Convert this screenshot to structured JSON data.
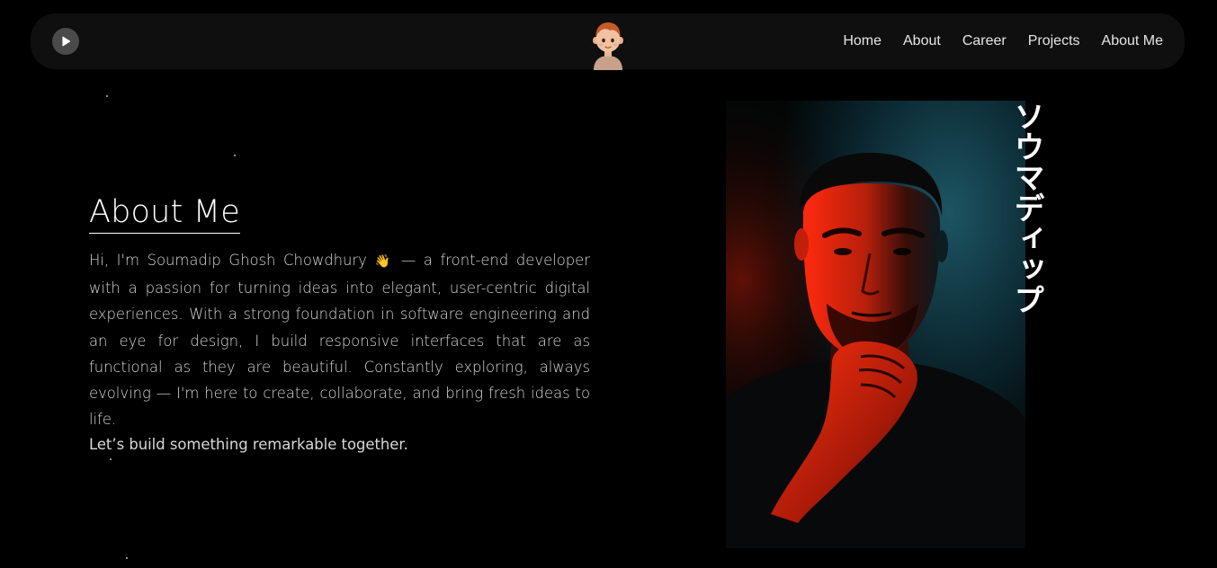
{
  "navbar": {
    "play_icon": "play-icon",
    "avatar_icon": "cartoon-boy-avatar",
    "links": [
      "Home",
      "About",
      "Career",
      "Projects",
      "About Me"
    ]
  },
  "about": {
    "title": "About Me",
    "intro_before_emoji": "Hi, I'm Soumadip Ghosh Chowdhury",
    "emoji": "👋",
    "paragraph_rest": "— a front-end developer with a passion for turning ideas into elegant, user-centric digital experiences. With a strong foundation in software engineering and an eye for design, I build responsive interfaces that are as functional as they are beautiful. Constantly exploring, always evolving — I'm here to create, collaborate, and bring fresh ideas to life.",
    "closing": "Let’s build something remarkable together."
  },
  "portrait": {
    "name_katakana": "ソウマディップ",
    "accent_colors": {
      "red": "#d8230f",
      "teal": "#0e3a45"
    }
  }
}
